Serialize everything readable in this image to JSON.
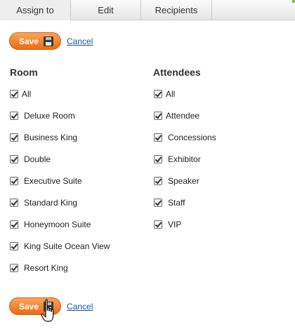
{
  "tabs": [
    {
      "label": "Assign to",
      "active": true
    },
    {
      "label": "Edit",
      "active": false
    },
    {
      "label": "Recipients",
      "active": false
    }
  ],
  "actions": {
    "save_label": "Save",
    "cancel_label": "Cancel"
  },
  "room": {
    "title": "Room",
    "items": [
      {
        "label": "All",
        "checked": true
      },
      {
        "label": "Deluxe Room",
        "checked": true
      },
      {
        "label": "Business King",
        "checked": true
      },
      {
        "label": "Double",
        "checked": true
      },
      {
        "label": "Executive Suite",
        "checked": true
      },
      {
        "label": "Standard King",
        "checked": true
      },
      {
        "label": "Honeymoon Suite",
        "checked": true
      },
      {
        "label": "King Suite Ocean View",
        "checked": true
      },
      {
        "label": "Resort King",
        "checked": true
      }
    ]
  },
  "attendees": {
    "title": "Attendees",
    "items": [
      {
        "label": "All",
        "checked": true
      },
      {
        "label": "Attendee",
        "checked": true
      },
      {
        "label": "Concessions",
        "checked": true
      },
      {
        "label": "Exhibitor",
        "checked": true
      },
      {
        "label": "Speaker",
        "checked": true
      },
      {
        "label": "Staff",
        "checked": true
      },
      {
        "label": "VIP",
        "checked": true
      }
    ]
  },
  "colors": {
    "accent": "#ec6b14",
    "link": "#1a56a8",
    "tab_accent": "#7bbf3a"
  },
  "icons": {
    "save": "floppy-disk-icon",
    "cursor": "hand-pointer-icon"
  }
}
